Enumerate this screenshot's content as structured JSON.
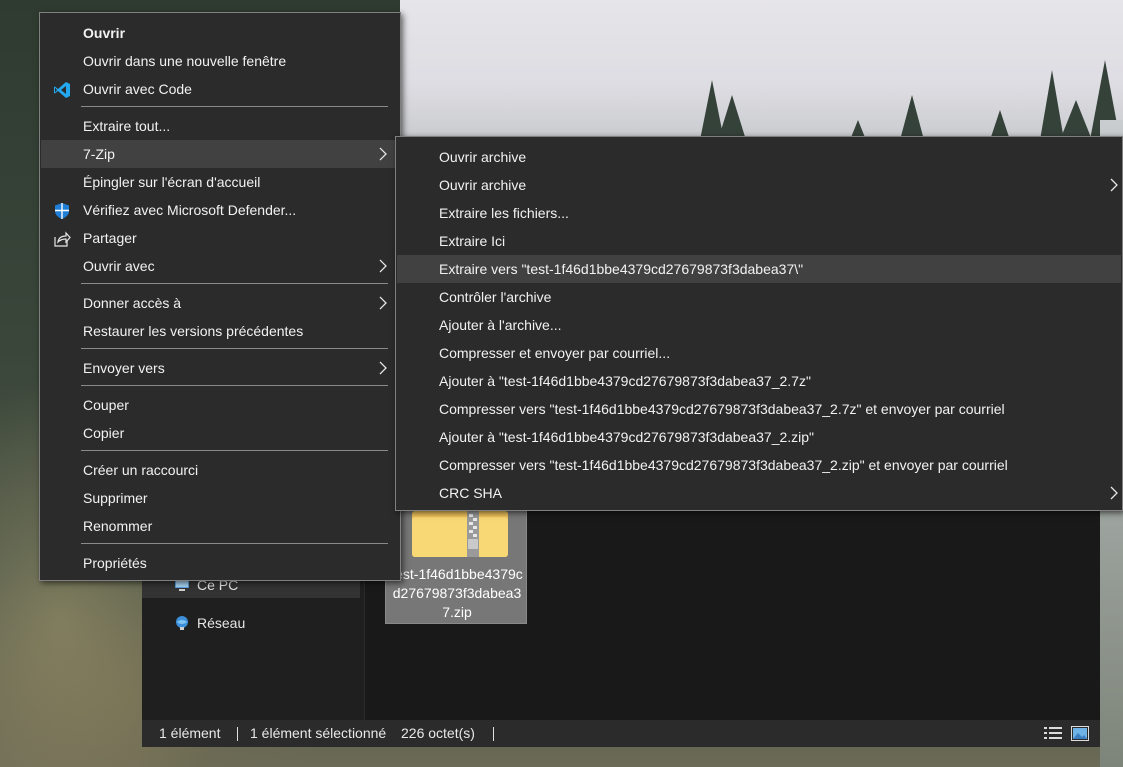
{
  "main_menu": {
    "items": [
      {
        "label": "Ouvrir"
      },
      {
        "label": "Ouvrir dans une nouvelle fenêtre"
      },
      {
        "label": "Ouvrir avec Code",
        "icon": "vscode-icon"
      },
      {
        "label": "Extraire tout..."
      },
      {
        "label": "7-Zip",
        "submenu": true
      },
      {
        "label": "Épingler sur l'écran d'accueil"
      },
      {
        "label": "Vérifiez avec Microsoft Defender...",
        "icon": "defender-shield-icon"
      },
      {
        "label": "Partager",
        "icon": "share-icon"
      },
      {
        "label": "Ouvrir avec",
        "submenu": true
      },
      {
        "label": "Donner accès à",
        "submenu": true
      },
      {
        "label": "Restaurer les versions précédentes"
      },
      {
        "label": "Envoyer vers",
        "submenu": true
      },
      {
        "label": "Couper"
      },
      {
        "label": "Copier"
      },
      {
        "label": "Créer un raccourci"
      },
      {
        "label": "Supprimer"
      },
      {
        "label": "Renommer"
      },
      {
        "label": "Propriétés"
      }
    ]
  },
  "sub_menu": {
    "items": [
      {
        "label": "Ouvrir archive"
      },
      {
        "label": "Ouvrir archive",
        "submenu": true
      },
      {
        "label": "Extraire les fichiers..."
      },
      {
        "label": "Extraire Ici"
      },
      {
        "label": "Extraire vers \"test-1f46d1bbe4379cd27679873f3dabea37\\\"",
        "highlighted": true
      },
      {
        "label": "Contrôler l'archive"
      },
      {
        "label": "Ajouter à l'archive..."
      },
      {
        "label": "Compresser et envoyer par courriel..."
      },
      {
        "label": "Ajouter à \"test-1f46d1bbe4379cd27679873f3dabea37_2.7z\""
      },
      {
        "label": "Compresser vers \"test-1f46d1bbe4379cd27679873f3dabea37_2.7z\" et envoyer par courriel"
      },
      {
        "label": "Ajouter à \"test-1f46d1bbe4379cd27679873f3dabea37_2.zip\""
      },
      {
        "label": "Compresser vers \"test-1f46d1bbe4379cd27679873f3dabea37_2.zip\" et envoyer par courriel"
      },
      {
        "label": "CRC SHA",
        "submenu": true
      }
    ]
  },
  "nav_pane": {
    "items": [
      {
        "label": "Ce PC",
        "icon": "computer-icon"
      },
      {
        "label": "Réseau",
        "icon": "network-icon"
      }
    ]
  },
  "file": {
    "name": "test-1f46d1bbe4379cd27679873f3dabea37.zip",
    "icon": "zip-folder-icon"
  },
  "status_bar": {
    "count": "1 élément",
    "selection": "1 élément sélectionné",
    "size": "226 octet(s)"
  },
  "colors": {
    "menu_bg": "#2b2b2b",
    "menu_highlight": "#414141",
    "menu_text": "#f2f2f2",
    "explorer_bg": "#191919",
    "vscode_blue": "#23a9f2",
    "zip_yellow": "#f8d775"
  }
}
